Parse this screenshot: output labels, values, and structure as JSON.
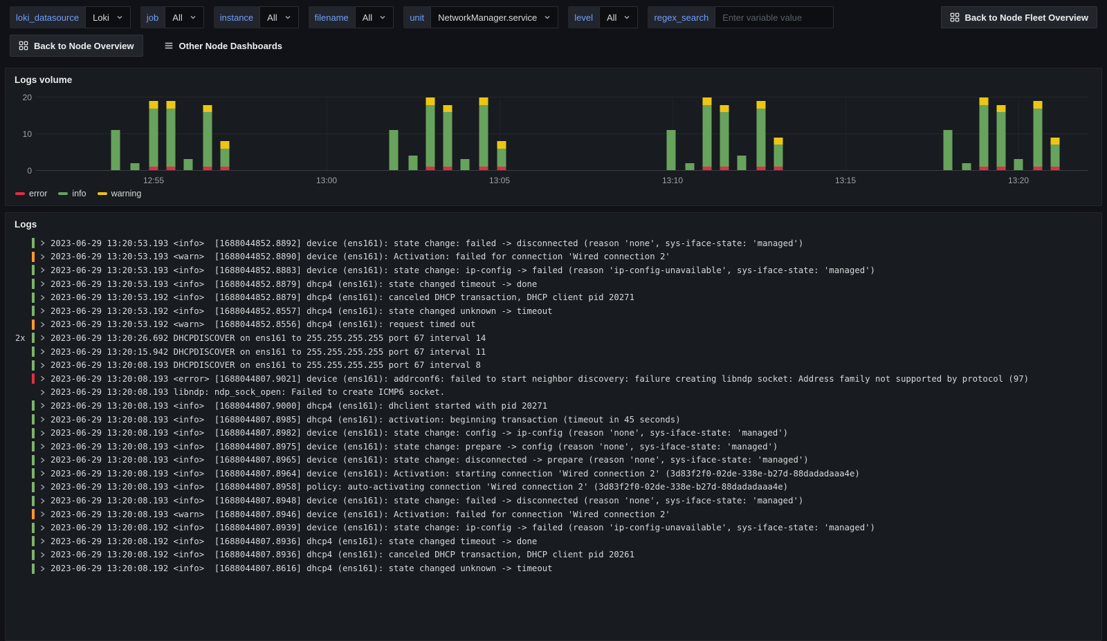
{
  "toolbar": {
    "variables": [
      {
        "label": "loki_datasource",
        "value": "Loki"
      },
      {
        "label": "job",
        "value": "All"
      },
      {
        "label": "instance",
        "value": "All"
      },
      {
        "label": "filename",
        "value": "All"
      },
      {
        "label": "unit",
        "value": "NetworkManager.service"
      },
      {
        "label": "level",
        "value": "All"
      },
      {
        "label": "regex_search",
        "placeholder": "Enter variable value"
      }
    ],
    "fleet_button": "Back to Node Fleet Overview",
    "node_button": "Back to Node Overview",
    "other_dashboards": "Other Node Dashboards",
    "accent_blue": "#6e9fff"
  },
  "panels": {
    "logs_volume_title": "Logs volume",
    "logs_title": "Logs"
  },
  "chart_data": {
    "type": "bar",
    "stacked": true,
    "title": "Logs volume",
    "x_min": 51.6,
    "x_max": 82.0,
    "y_max": 20,
    "y_ticks": [
      0,
      10,
      20
    ],
    "x_ticks": [
      {
        "t": 55,
        "label": "12:55"
      },
      {
        "t": 60,
        "label": "13:00"
      },
      {
        "t": 65,
        "label": "13:05"
      },
      {
        "t": 70,
        "label": "13:10"
      },
      {
        "t": 75,
        "label": "13:15"
      },
      {
        "t": 80,
        "label": "13:20"
      }
    ],
    "legend": [
      {
        "name": "error",
        "color": "#e02f44"
      },
      {
        "name": "info",
        "color": "#67a35c"
      },
      {
        "name": "warning",
        "color": "#edc514"
      }
    ],
    "colors": {
      "error": "#e02f44",
      "info": "#67a35c",
      "warning": "#edc514"
    },
    "bars": [
      {
        "t": 53.9,
        "error": 0,
        "info": 11,
        "warning": 0
      },
      {
        "t": 54.45,
        "error": 0,
        "info": 2,
        "warning": 0
      },
      {
        "t": 55.0,
        "error": 1,
        "info": 16,
        "warning": 2
      },
      {
        "t": 55.5,
        "error": 1,
        "info": 16,
        "warning": 2
      },
      {
        "t": 56.0,
        "error": 0,
        "info": 3,
        "warning": 0
      },
      {
        "t": 56.55,
        "error": 1,
        "info": 15,
        "warning": 2
      },
      {
        "t": 57.05,
        "error": 1,
        "info": 5,
        "warning": 2
      },
      {
        "t": 61.95,
        "error": 0,
        "info": 11,
        "warning": 0
      },
      {
        "t": 62.5,
        "error": 0,
        "info": 4,
        "warning": 0
      },
      {
        "t": 63.0,
        "error": 1,
        "info": 17,
        "warning": 2
      },
      {
        "t": 63.5,
        "error": 1,
        "info": 15,
        "warning": 2
      },
      {
        "t": 64.0,
        "error": 0,
        "info": 3,
        "warning": 0
      },
      {
        "t": 64.55,
        "error": 1,
        "info": 17,
        "warning": 2
      },
      {
        "t": 65.05,
        "error": 1,
        "info": 5,
        "warning": 2
      },
      {
        "t": 69.95,
        "error": 0,
        "info": 11,
        "warning": 0
      },
      {
        "t": 70.5,
        "error": 0,
        "info": 2,
        "warning": 0
      },
      {
        "t": 71.0,
        "error": 1,
        "info": 17,
        "warning": 2
      },
      {
        "t": 71.5,
        "error": 1,
        "info": 15,
        "warning": 2
      },
      {
        "t": 72.0,
        "error": 0,
        "info": 4,
        "warning": 0
      },
      {
        "t": 72.55,
        "error": 1,
        "info": 16,
        "warning": 2
      },
      {
        "t": 73.05,
        "error": 1,
        "info": 6,
        "warning": 2
      },
      {
        "t": 77.95,
        "error": 0,
        "info": 11,
        "warning": 0
      },
      {
        "t": 78.5,
        "error": 0,
        "info": 2,
        "warning": 0
      },
      {
        "t": 79.0,
        "error": 1,
        "info": 17,
        "warning": 2
      },
      {
        "t": 79.5,
        "error": 1,
        "info": 15,
        "warning": 2
      },
      {
        "t": 80.0,
        "error": 0,
        "info": 3,
        "warning": 0
      },
      {
        "t": 80.55,
        "error": 1,
        "info": 16,
        "warning": 2
      },
      {
        "t": 81.05,
        "error": 1,
        "info": 6,
        "warning": 2
      }
    ]
  },
  "logs": {
    "level_colors": {
      "info": "#7eb26d",
      "warn": "#ff9830",
      "error": "#e02f44",
      "unknown": "transparent"
    },
    "entries": [
      {
        "level": "info",
        "text": "2023-06-29 13:20:53.193 <info>  [1688044852.8892] device (ens161): state change: failed -> disconnected (reason 'none', sys-iface-state: 'managed')"
      },
      {
        "level": "warn",
        "text": "2023-06-29 13:20:53.193 <warn>  [1688044852.8890] device (ens161): Activation: failed for connection 'Wired connection 2'"
      },
      {
        "level": "info",
        "text": "2023-06-29 13:20:53.193 <info>  [1688044852.8883] device (ens161): state change: ip-config -> failed (reason 'ip-config-unavailable', sys-iface-state: 'managed')"
      },
      {
        "level": "info",
        "text": "2023-06-29 13:20:53.193 <info>  [1688044852.8879] dhcp4 (ens161): state changed timeout -> done"
      },
      {
        "level": "info",
        "text": "2023-06-29 13:20:53.192 <info>  [1688044852.8879] dhcp4 (ens161): canceled DHCP transaction, DHCP client pid 20271"
      },
      {
        "level": "info",
        "text": "2023-06-29 13:20:53.192 <info>  [1688044852.8557] dhcp4 (ens161): state changed unknown -> timeout"
      },
      {
        "level": "warn",
        "text": "2023-06-29 13:20:53.192 <warn>  [1688044852.8556] dhcp4 (ens161): request timed out"
      },
      {
        "level": "info",
        "dup": "2x",
        "text": "2023-06-29 13:20:26.692 DHCPDISCOVER on ens161 to 255.255.255.255 port 67 interval 14"
      },
      {
        "level": "info",
        "text": "2023-06-29 13:20:15.942 DHCPDISCOVER on ens161 to 255.255.255.255 port 67 interval 11"
      },
      {
        "level": "info",
        "text": "2023-06-29 13:20:08.193 DHCPDISCOVER on ens161 to 255.255.255.255 port 67 interval 8"
      },
      {
        "level": "error",
        "text": "2023-06-29 13:20:08.193 <error> [1688044807.9021] device (ens161): addrconf6: failed to start neighbor discovery: failure creating libndp socket: Address family not supported by protocol (97)"
      },
      {
        "level": "unknown",
        "text": "2023-06-29 13:20:08.193 libndp: ndp_sock_open: Failed to create ICMP6 socket."
      },
      {
        "level": "info",
        "text": "2023-06-29 13:20:08.193 <info>  [1688044807.9000] dhcp4 (ens161): dhclient started with pid 20271"
      },
      {
        "level": "info",
        "text": "2023-06-29 13:20:08.193 <info>  [1688044807.8985] dhcp4 (ens161): activation: beginning transaction (timeout in 45 seconds)"
      },
      {
        "level": "info",
        "text": "2023-06-29 13:20:08.193 <info>  [1688044807.8982] device (ens161): state change: config -> ip-config (reason 'none', sys-iface-state: 'managed')"
      },
      {
        "level": "info",
        "text": "2023-06-29 13:20:08.193 <info>  [1688044807.8975] device (ens161): state change: prepare -> config (reason 'none', sys-iface-state: 'managed')"
      },
      {
        "level": "info",
        "text": "2023-06-29 13:20:08.193 <info>  [1688044807.8965] device (ens161): state change: disconnected -> prepare (reason 'none', sys-iface-state: 'managed')"
      },
      {
        "level": "info",
        "text": "2023-06-29 13:20:08.193 <info>  [1688044807.8964] device (ens161): Activation: starting connection 'Wired connection 2' (3d83f2f0-02de-338e-b27d-88dadadaaa4e)"
      },
      {
        "level": "info",
        "text": "2023-06-29 13:20:08.193 <info>  [1688044807.8958] policy: auto-activating connection 'Wired connection 2' (3d83f2f0-02de-338e-b27d-88dadadaaa4e)"
      },
      {
        "level": "info",
        "text": "2023-06-29 13:20:08.193 <info>  [1688044807.8948] device (ens161): state change: failed -> disconnected (reason 'none', sys-iface-state: 'managed')"
      },
      {
        "level": "warn",
        "text": "2023-06-29 13:20:08.193 <warn>  [1688044807.8946] device (ens161): Activation: failed for connection 'Wired connection 2'"
      },
      {
        "level": "info",
        "text": "2023-06-29 13:20:08.192 <info>  [1688044807.8939] device (ens161): state change: ip-config -> failed (reason 'ip-config-unavailable', sys-iface-state: 'managed')"
      },
      {
        "level": "info",
        "text": "2023-06-29 13:20:08.192 <info>  [1688044807.8936] dhcp4 (ens161): state changed timeout -> done"
      },
      {
        "level": "info",
        "text": "2023-06-29 13:20:08.192 <info>  [1688044807.8936] dhcp4 (ens161): canceled DHCP transaction, DHCP client pid 20261"
      },
      {
        "level": "info",
        "text": "2023-06-29 13:20:08.192 <info>  [1688044807.8616] dhcp4 (ens161): state changed unknown -> timeout"
      }
    ]
  }
}
